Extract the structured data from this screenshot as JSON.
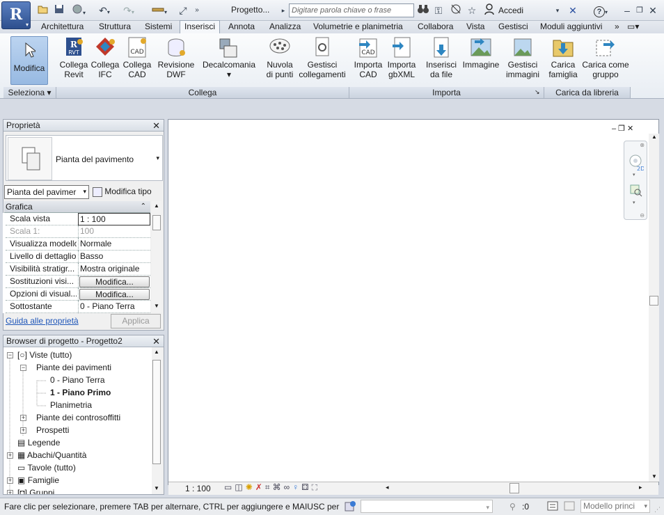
{
  "titlebar": {
    "doc_title": "Progetto...",
    "search_placeholder": "Digitare parola chiave o frase",
    "signin": "Accedi"
  },
  "tabs": [
    "Architettura",
    "Struttura",
    "Sistemi",
    "Inserisci",
    "Annota",
    "Analizza",
    "Volumetrie e planimetria",
    "Collabora",
    "Vista",
    "Gestisci",
    "Moduli aggiuntivi"
  ],
  "active_tab": "Inserisci",
  "ribbon": {
    "modifica": "Modifica",
    "buttons": [
      {
        "l1": "Collega",
        "l2": "Revit"
      },
      {
        "l1": "Collega",
        "l2": "IFC"
      },
      {
        "l1": "Collega",
        "l2": "CAD"
      },
      {
        "l1": "Revisione",
        "l2": "DWF"
      },
      {
        "l1": "Decalcomania",
        "l2": "▾"
      },
      {
        "l1": "Nuvola",
        "l2": "di punti"
      },
      {
        "l1": "Gestisci",
        "l2": "collegamenti"
      },
      {
        "l1": "Importa",
        "l2": "CAD"
      },
      {
        "l1": "Importa",
        "l2": "gbXML"
      },
      {
        "l1": "Inserisci",
        "l2": "da file"
      },
      {
        "l1": "Immagine",
        "l2": ""
      },
      {
        "l1": "Gestisci",
        "l2": "immagini"
      },
      {
        "l1": "Carica",
        "l2": "famiglia"
      },
      {
        "l1": "Carica come",
        "l2": "gruppo"
      }
    ],
    "panels": [
      "Seleziona ▾",
      "Collega",
      "Importa",
      "Carica da libreria"
    ]
  },
  "properties": {
    "title": "Proprietà",
    "type_name": "Pianta del pavimento",
    "instance_select": "Pianta del pavimer",
    "edit_type": "Modifica tipo",
    "group": "Grafica",
    "rows": [
      {
        "k": "Scala vista",
        "v": "1 : 100"
      },
      {
        "k": "Scala 1:",
        "v": "100"
      },
      {
        "k": "Visualizza modello",
        "v": "Normale"
      },
      {
        "k": "Livello di dettaglio",
        "v": "Basso"
      },
      {
        "k": "Visibilità stratigr...",
        "v": "Mostra originale"
      },
      {
        "k": "Sostituzioni visi...",
        "v": "Modifica..."
      },
      {
        "k": "Opzioni di visual...",
        "v": "Modifica..."
      },
      {
        "k": "Sottostante",
        "v": "0 - Piano Terra"
      }
    ],
    "help_link": "Guida alle proprietà",
    "apply": "Applica"
  },
  "browser": {
    "title": "Browser di progetto - Progetto2",
    "items": [
      {
        "label": "Viste (tutto)"
      },
      {
        "label": "Piante dei pavimenti"
      },
      {
        "label": "0 - Piano Terra"
      },
      {
        "label": "1 - Piano Primo"
      },
      {
        "label": "Planimetria"
      },
      {
        "label": "Piante dei controsoffitti"
      },
      {
        "label": "Prospetti"
      },
      {
        "label": "Legende"
      },
      {
        "label": "Abachi/Quantità"
      },
      {
        "label": "Tavole (tutto)"
      },
      {
        "label": "Famiglie"
      },
      {
        "label": "Gruppi"
      }
    ]
  },
  "viewbar": {
    "scale": "1 : 100"
  },
  "status": {
    "message": "Fare clic per selezionare, premere TAB per alternare, CTRL per aggiungere e MAIUSC per des",
    "count": ":0",
    "model": "Modello princi"
  }
}
